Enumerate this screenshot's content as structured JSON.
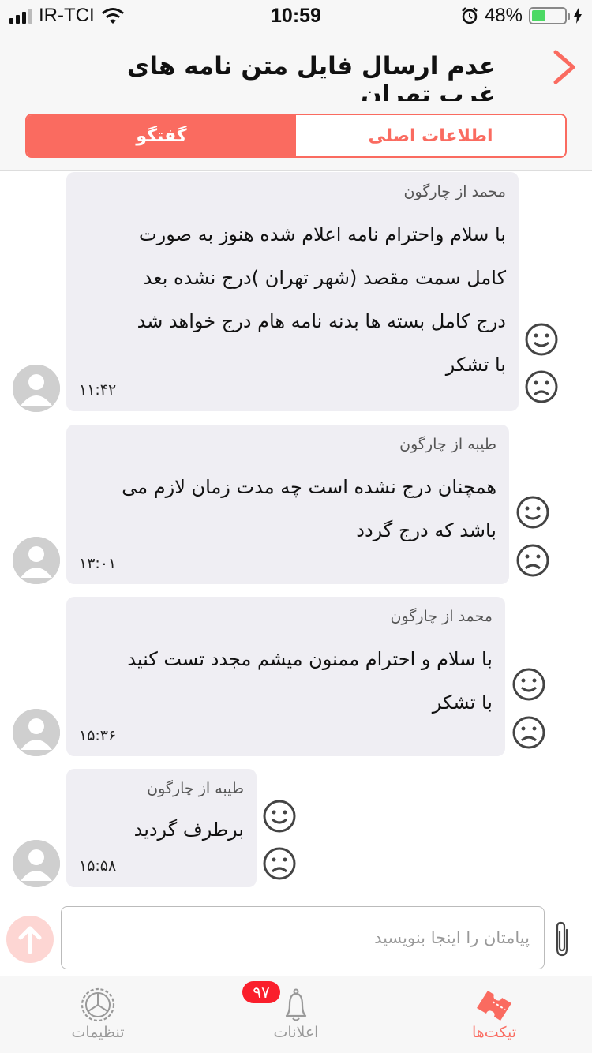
{
  "status_bar": {
    "carrier": "IR-TCI",
    "time": "10:59",
    "battery": "48%",
    "battery_level": 0.48
  },
  "header": {
    "title": "عدم ارسال فایل متن نامه های غرب تهران",
    "back_icon": "chevron-right-icon"
  },
  "tabs": {
    "info_label": "اطلاعات اصلی",
    "chat_label": "گفتگو",
    "active": "chat"
  },
  "messages": [
    {
      "sender": "محمد از چارگون",
      "text": "با سلام واحترام نامه اعلام شده  هنوز به صورت\nکامل سمت مقصد (شهر تهران )درج نشده  بعد\nدرج کامل بسته ها بدنه نامه هام درج خواهد شد\nبا تشکر",
      "time": "۱۱:۴۲"
    },
    {
      "sender": "طیبه از چارگون",
      "text": "همچنان درج نشده است چه مدت زمان لازم می\nباشد که درج گردد",
      "time": "۱۳:۰۱"
    },
    {
      "sender": "محمد از چارگون",
      "text": "با سلام و احترام ممنون میشم مجدد تست کنید\nبا تشکر",
      "time": "۱۵:۳۶"
    },
    {
      "sender": "طیبه از چارگون",
      "text": "برطرف گردید",
      "time": "۱۵:۵۸"
    }
  ],
  "composer": {
    "placeholder": "پیامتان را اینجا بنویسید",
    "send_icon": "arrow-up-icon",
    "attach_icon": "paperclip-icon"
  },
  "tabbar": {
    "tickets_label": "تیکت‌ها",
    "notifications_label": "اعلانات",
    "notifications_badge": "۹۷",
    "settings_label": "تنظیمات"
  },
  "colors": {
    "accent": "#fa6b60",
    "bubble": "#efeef3",
    "badge": "#fa1f2c"
  }
}
